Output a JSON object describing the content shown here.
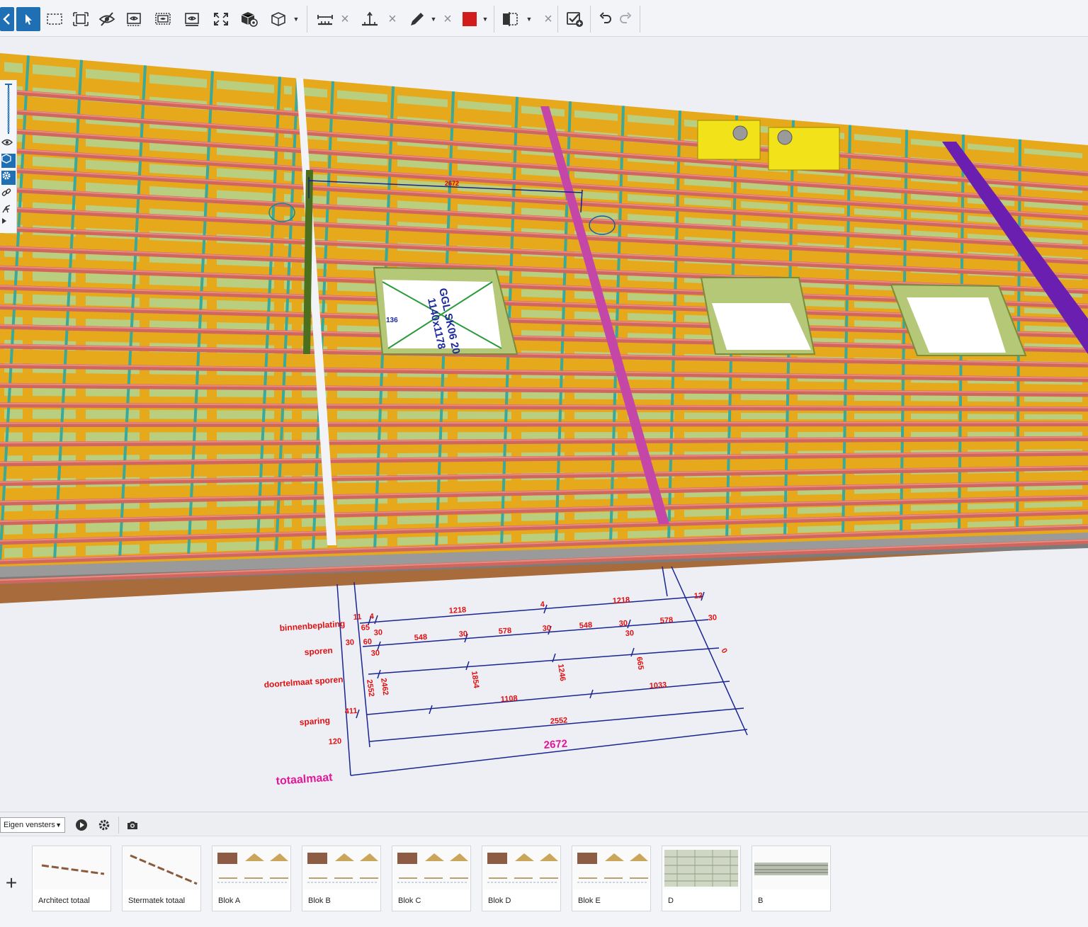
{
  "toolbar": {
    "buttons": [
      {
        "name": "collapse-panel-icon"
      },
      {
        "name": "select-arrow-icon"
      },
      {
        "name": "box-select-icon"
      },
      {
        "name": "fit-selection-icon"
      },
      {
        "name": "hide-eye-icon"
      },
      {
        "name": "view-filter-icon"
      },
      {
        "name": "view-filter-2-icon"
      },
      {
        "name": "view-filter-3-icon"
      },
      {
        "name": "fullscreen-icon"
      },
      {
        "name": "cube-settings-icon"
      },
      {
        "name": "cube-view-icon"
      },
      {
        "name": "measure-horizontal-icon"
      },
      {
        "name": "measure-vertical-icon"
      },
      {
        "name": "pencil-icon"
      },
      {
        "name": "color-swatch-icon"
      },
      {
        "name": "section-box-icon"
      },
      {
        "name": "check-add-icon"
      },
      {
        "name": "undo-icon"
      },
      {
        "name": "redo-icon"
      }
    ],
    "swatch_color": "#d21b1b",
    "accent_color": "#1f6fb5"
  },
  "viewport": {
    "dimension_labels": {
      "binnenbeplating": "binnenbeplating",
      "sporen": "sporen",
      "doortelmaat": "doortelmaat sporen",
      "sparing": "sparing",
      "totaalmaat": "totaalmaat"
    },
    "dimension_values": {
      "r1": [
        "11",
        "4",
        "1218",
        "4",
        "1218",
        "12"
      ],
      "r1b": [
        "65",
        "30",
        "578",
        "30"
      ],
      "r2": [
        "30",
        "60",
        "548",
        "30",
        "578",
        "30",
        "548",
        "30",
        "30",
        "0"
      ],
      "r2b": [
        "30",
        "30"
      ],
      "r3": [
        "2462",
        "2552",
        "1854",
        "1246",
        "665"
      ],
      "r4": [
        "411",
        "1108",
        "1033"
      ],
      "r5": [
        "120",
        "2552"
      ],
      "total": "2672"
    },
    "model_labels": {
      "window_tag": "GGL SK06 20",
      "window_size": "1140x1178",
      "top_dim": "2672",
      "tag_136": "136"
    }
  },
  "bottom_panel": {
    "dropdown_value": "Eigen vensters",
    "add_label": "+",
    "views": [
      {
        "label": "Architect totaal"
      },
      {
        "label": "Stermatek totaal"
      },
      {
        "label": "Blok A"
      },
      {
        "label": "Blok B"
      },
      {
        "label": "Blok C"
      },
      {
        "label": "Blok D"
      },
      {
        "label": "Blok E"
      },
      {
        "label": "D"
      },
      {
        "label": "B"
      }
    ]
  }
}
